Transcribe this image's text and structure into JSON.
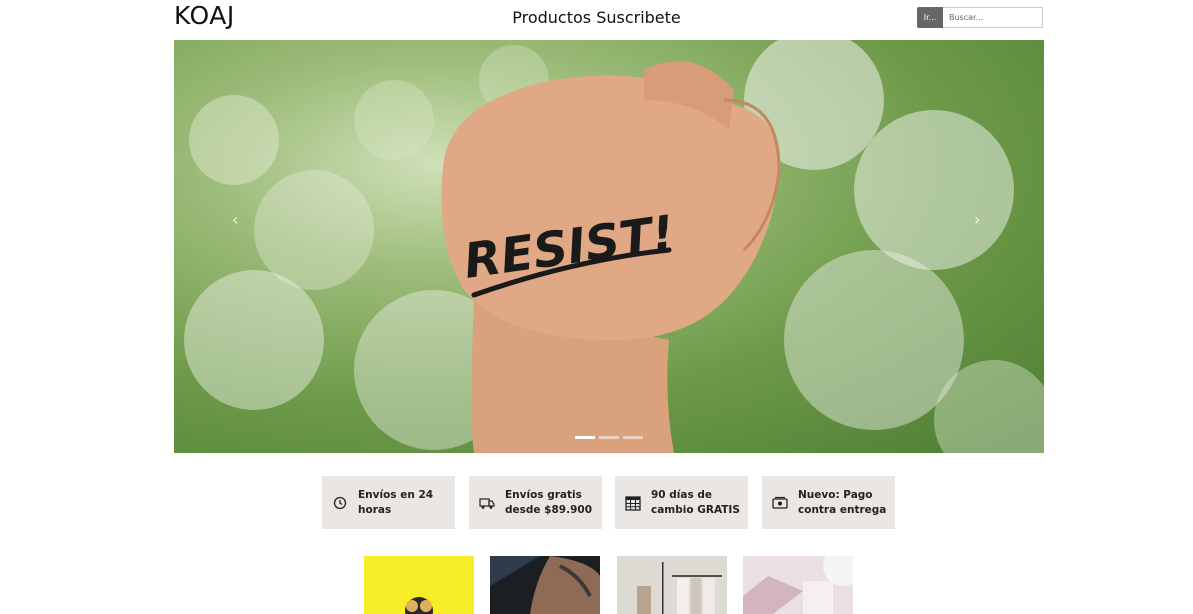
{
  "header": {
    "logo": "KOAJ",
    "nav": {
      "productos": "Productos",
      "suscribete": "Suscribete"
    },
    "search": {
      "button_label": "Ir...",
      "placeholder": "Buscar..."
    }
  },
  "hero": {
    "slide_text": "RESIST!",
    "slide_count": 3,
    "active_slide": 1,
    "prev_icon": "chevron-left-icon",
    "next_icon": "chevron-right-icon"
  },
  "features": [
    {
      "icon": "clock-icon",
      "line1": "Envíos en 24",
      "line2": "horas"
    },
    {
      "icon": "truck-icon",
      "line1": "Envíos gratis",
      "line2": "desde $89.900"
    },
    {
      "icon": "calendar-icon",
      "line1": "90 días de",
      "line2": "cambio GRATIS"
    },
    {
      "icon": "cash-icon",
      "line1": "Nuevo: Pago",
      "line2": "contra entrega"
    }
  ],
  "colors": {
    "feature_bg": "#e9e6e4",
    "search_button": "#666666",
    "hero_green": "#6c9a48"
  }
}
